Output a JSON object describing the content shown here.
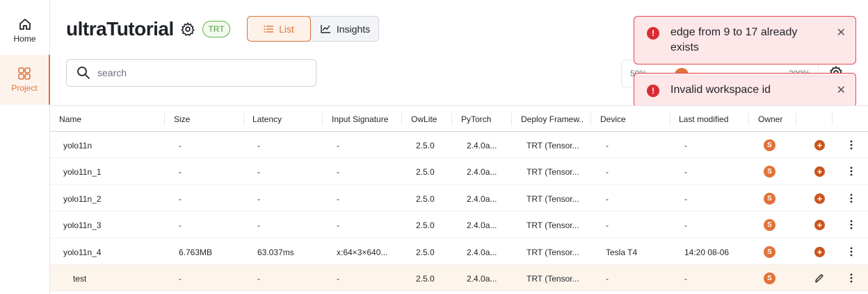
{
  "sidebar": {
    "items": [
      {
        "label": "Home",
        "icon": "home-icon"
      },
      {
        "label": "Project",
        "icon": "grid-icon",
        "active": true
      }
    ]
  },
  "header": {
    "title": "ultraTutorial",
    "badge": "TRT",
    "views": {
      "list": "List",
      "insights": "Insights",
      "active": "List"
    }
  },
  "search": {
    "placeholder": "search",
    "value": ""
  },
  "zoom": {
    "min_label": "50%",
    "max_label": "200%",
    "level": 0.2
  },
  "toasts": [
    {
      "message": "edge from 9 to 17 already exists",
      "type": "error"
    },
    {
      "message": "Invalid workspace id",
      "type": "error"
    }
  ],
  "table": {
    "columns": [
      "Name",
      "Size",
      "Latency",
      "Input Signature",
      "OwLite",
      "PyTorch",
      "Deploy Framew...",
      "Device",
      "Last modified",
      "Owner"
    ],
    "rows": [
      {
        "name": "yolo11n",
        "size": "-",
        "latency": "-",
        "input": "-",
        "owlite": "2.5.0",
        "pytorch": "2.4.0a...",
        "deploy": "TRT (Tensor...",
        "device": "-",
        "modified": "-",
        "owner": "S"
      },
      {
        "name": "yolo11n_1",
        "size": "-",
        "latency": "-",
        "input": "-",
        "owlite": "2.5.0",
        "pytorch": "2.4.0a...",
        "deploy": "TRT (Tensor...",
        "device": "-",
        "modified": "-",
        "owner": "S"
      },
      {
        "name": "yolo11n_2",
        "size": "-",
        "latency": "-",
        "input": "-",
        "owlite": "2.5.0",
        "pytorch": "2.4.0a...",
        "deploy": "TRT (Tensor...",
        "device": "-",
        "modified": "-",
        "owner": "S"
      },
      {
        "name": "yolo11n_3",
        "size": "-",
        "latency": "-",
        "input": "-",
        "owlite": "2.5.0",
        "pytorch": "2.4.0a...",
        "deploy": "TRT (Tensor...",
        "device": "-",
        "modified": "-",
        "owner": "S"
      },
      {
        "name": "yolo11n_4",
        "size": "6.763MB",
        "latency": "63.037ms",
        "input": "x:64×3×640...",
        "owlite": "2.5.0",
        "pytorch": "2.4.0a...",
        "deploy": "TRT (Tensor...",
        "device": "Tesla T4",
        "modified": "14:20 08-06",
        "owner": "S"
      },
      {
        "name": "test",
        "size": "-",
        "latency": "-",
        "input": "-",
        "owlite": "2.5.0",
        "pytorch": "2.4.0a...",
        "deploy": "TRT (Tensor...",
        "device": "-",
        "modified": "-",
        "owner": "S",
        "sub": true
      }
    ]
  },
  "colors": {
    "accent": "#e0733a",
    "error": "#d92d34",
    "badge": "#4d9a3a"
  }
}
